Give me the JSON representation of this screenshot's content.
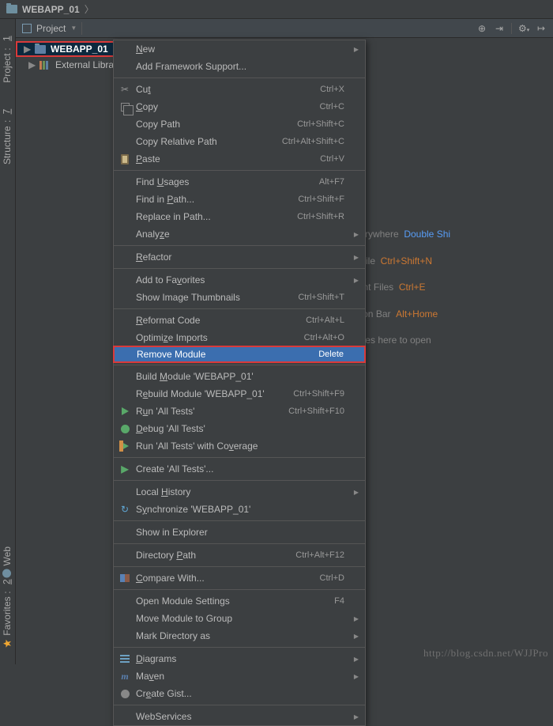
{
  "topbar": {
    "title": "WEBAPP_01"
  },
  "sidebar": {
    "project": {
      "num": "1",
      "label": "Project"
    },
    "structure": {
      "num": "7",
      "label": "Structure"
    },
    "web": {
      "label": "Web"
    },
    "favorites": {
      "num": "2",
      "label": "Favorites"
    }
  },
  "projectPanel": {
    "selector": "Project",
    "tools": [
      "⟳",
      "⎘",
      "┆",
      "⚙",
      "↤"
    ]
  },
  "tree": {
    "root": "WEBAPP_01",
    "lib": "External Librar"
  },
  "hints": {
    "l1a": "Search Everywhere",
    "l1b": "Double Shi",
    "l2a": "Go to File",
    "l2b": "Ctrl+Shift+N",
    "l3a": "Recent Files",
    "l3b": "Ctrl+E",
    "l4a": "Navigation Bar",
    "l4b": "Alt+Home",
    "l5": "Drop files here to open"
  },
  "menu": [
    {
      "type": "item",
      "label": "New",
      "sub": true,
      "ul": "N"
    },
    {
      "type": "item",
      "label": "Add Framework Support..."
    },
    {
      "type": "sep"
    },
    {
      "type": "item",
      "label": "Cut",
      "short": "Ctrl+X",
      "icon": "scissors",
      "ul": "t"
    },
    {
      "type": "item",
      "label": "Copy",
      "short": "Ctrl+C",
      "icon": "copy",
      "ul": "C"
    },
    {
      "type": "item",
      "label": "Copy Path",
      "short": "Ctrl+Shift+C"
    },
    {
      "type": "item",
      "label": "Copy Relative Path",
      "short": "Ctrl+Alt+Shift+C"
    },
    {
      "type": "item",
      "label": "Paste",
      "short": "Ctrl+V",
      "icon": "paste",
      "ul": "P"
    },
    {
      "type": "sep"
    },
    {
      "type": "item",
      "label": "Find Usages",
      "short": "Alt+F7",
      "ul": "U"
    },
    {
      "type": "item",
      "label": "Find in Path...",
      "short": "Ctrl+Shift+F",
      "ul": "P"
    },
    {
      "type": "item",
      "label": "Replace in Path...",
      "short": "Ctrl+Shift+R"
    },
    {
      "type": "item",
      "label": "Analyze",
      "sub": true,
      "ul": "z"
    },
    {
      "type": "sep"
    },
    {
      "type": "item",
      "label": "Refactor",
      "sub": true,
      "ul": "R"
    },
    {
      "type": "sep"
    },
    {
      "type": "item",
      "label": "Add to Favorites",
      "sub": true,
      "ul": "v"
    },
    {
      "type": "item",
      "label": "Show Image Thumbnails",
      "short": "Ctrl+Shift+T"
    },
    {
      "type": "sep"
    },
    {
      "type": "item",
      "label": "Reformat Code",
      "short": "Ctrl+Alt+L",
      "ul": "R"
    },
    {
      "type": "item",
      "label": "Optimize Imports",
      "short": "Ctrl+Alt+O",
      "ul": "z"
    },
    {
      "type": "item",
      "label": "Remove Module",
      "short": "Delete",
      "hl": true,
      "redbox": true
    },
    {
      "type": "sep"
    },
    {
      "type": "item",
      "label": "Build Module 'WEBAPP_01'",
      "ul": "M"
    },
    {
      "type": "item",
      "label": "Rebuild Module 'WEBAPP_01'",
      "short": "Ctrl+Shift+F9",
      "ul": "e"
    },
    {
      "type": "item",
      "label": "Run 'All Tests'",
      "short": "Ctrl+Shift+F10",
      "icon": "play",
      "ul": "u"
    },
    {
      "type": "item",
      "label": "Debug 'All Tests'",
      "icon": "bug",
      "ul": "D"
    },
    {
      "type": "item",
      "label": "Run 'All Tests' with Coverage",
      "icon": "cover",
      "ul": "v"
    },
    {
      "type": "sep"
    },
    {
      "type": "item",
      "label": "Create 'All Tests'...",
      "icon": "create"
    },
    {
      "type": "sep"
    },
    {
      "type": "item",
      "label": "Local History",
      "sub": true,
      "ul": "H"
    },
    {
      "type": "item",
      "label": "Synchronize 'WEBAPP_01'",
      "icon": "sync",
      "ul": "y"
    },
    {
      "type": "sep"
    },
    {
      "type": "item",
      "label": "Show in Explorer"
    },
    {
      "type": "sep"
    },
    {
      "type": "item",
      "label": "Directory Path",
      "short": "Ctrl+Alt+F12",
      "ul": "P"
    },
    {
      "type": "sep"
    },
    {
      "type": "item",
      "label": "Compare With...",
      "short": "Ctrl+D",
      "icon": "diff",
      "ul": "C"
    },
    {
      "type": "sep"
    },
    {
      "type": "item",
      "label": "Open Module Settings",
      "short": "F4"
    },
    {
      "type": "item",
      "label": "Move Module to Group",
      "sub": true
    },
    {
      "type": "item",
      "label": "Mark Directory as",
      "sub": true
    },
    {
      "type": "sep"
    },
    {
      "type": "item",
      "label": "Diagrams",
      "sub": true,
      "icon": "diag",
      "ul": "D"
    },
    {
      "type": "item",
      "label": "Maven",
      "sub": true,
      "icon": "maven",
      "ul": "v"
    },
    {
      "type": "item",
      "label": "Create Gist...",
      "icon": "gist",
      "ul": "e"
    },
    {
      "type": "sep"
    },
    {
      "type": "item",
      "label": "WebServices",
      "sub": true
    }
  ],
  "watermark": "http://blog.csdn.net/WJJPro"
}
